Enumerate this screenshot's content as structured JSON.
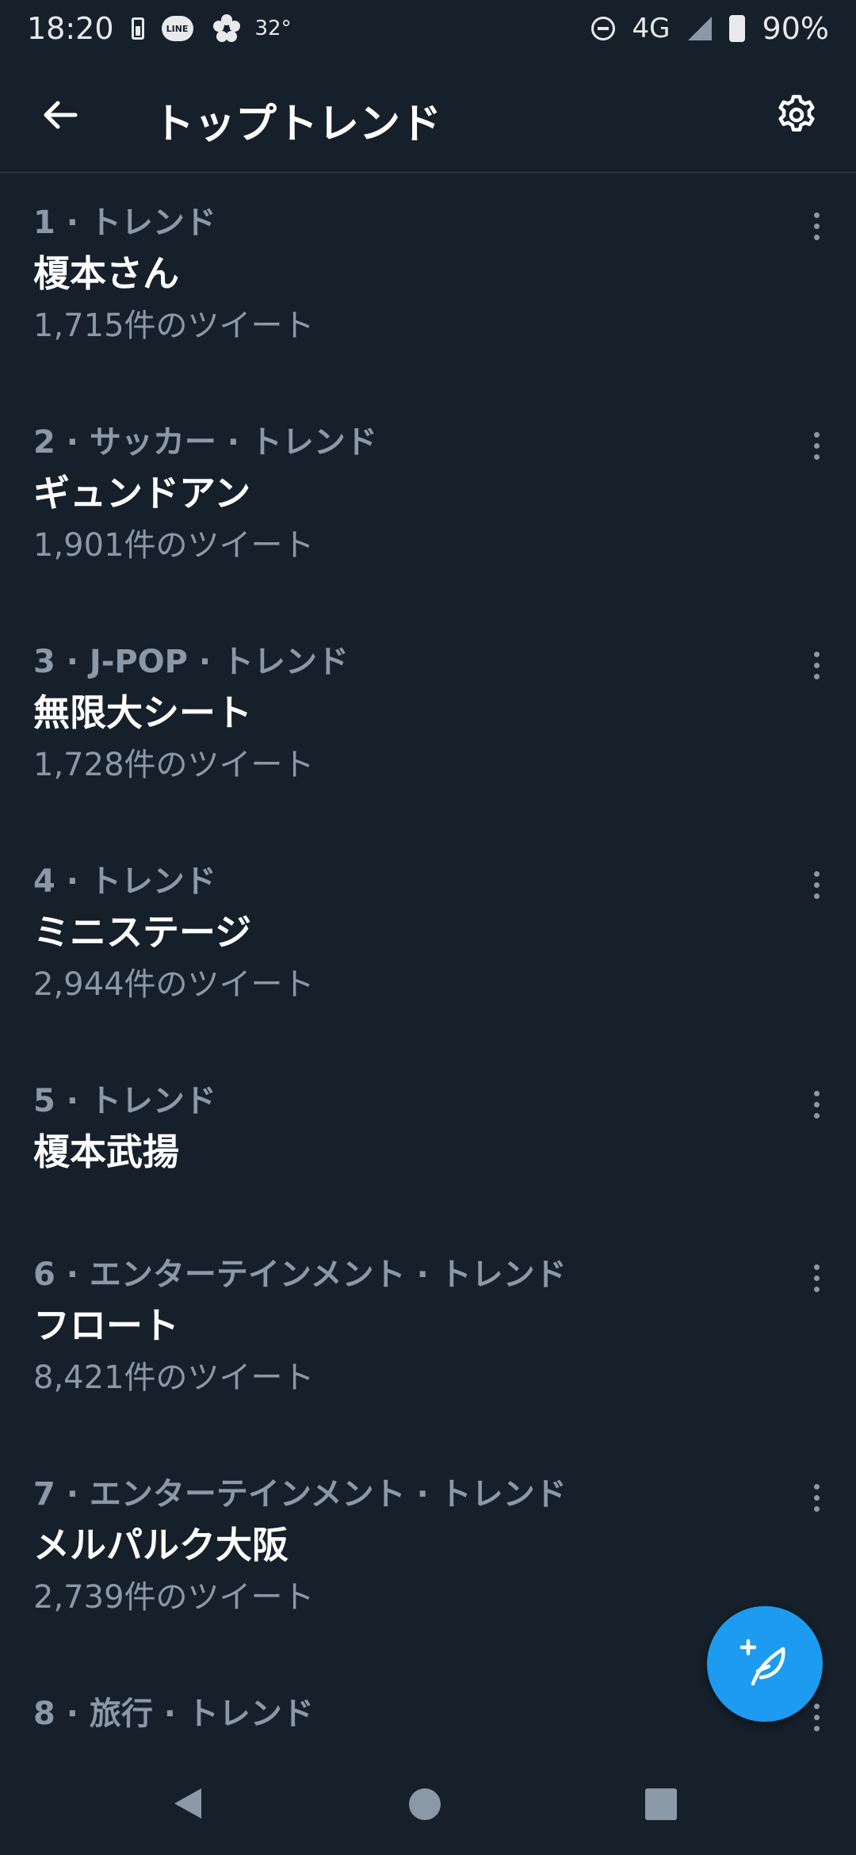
{
  "status_bar": {
    "time": "18:20",
    "line_label": "LINE",
    "temperature": "32°",
    "network": "4G",
    "battery": "90%"
  },
  "header": {
    "title": "トップトレンド"
  },
  "trends": [
    {
      "meta": "1 · トレンド",
      "name": "榎本さん",
      "count": "1,715件のツイート"
    },
    {
      "meta": "2 · サッカー · トレンド",
      "name": "ギュンドアン",
      "count": "1,901件のツイート"
    },
    {
      "meta": "3 · J-POP · トレンド",
      "name": "無限大シート",
      "count": "1,728件のツイート"
    },
    {
      "meta": "4 · トレンド",
      "name": "ミニステージ",
      "count": "2,944件のツイート"
    },
    {
      "meta": "5 · トレンド",
      "name": "榎本武揚",
      "count": ""
    },
    {
      "meta": "6 · エンターテインメント · トレンド",
      "name": "フロート",
      "count": "8,421件のツイート"
    },
    {
      "meta": "7 · エンターテインメント · トレンド",
      "name": "メルパルク大阪",
      "count": "2,739件のツイート"
    },
    {
      "meta": "8 · 旅行 · トレンド",
      "name": "",
      "count": ""
    }
  ],
  "colors": {
    "background": "#15202b",
    "accent": "#1d9bf0",
    "secondary_text": "#8b98a5",
    "divider": "#38444d"
  },
  "icons": {
    "back": "arrow-left-icon",
    "settings": "gear-icon",
    "more": "vertical-dots-icon",
    "compose": "feather-plus-icon"
  }
}
